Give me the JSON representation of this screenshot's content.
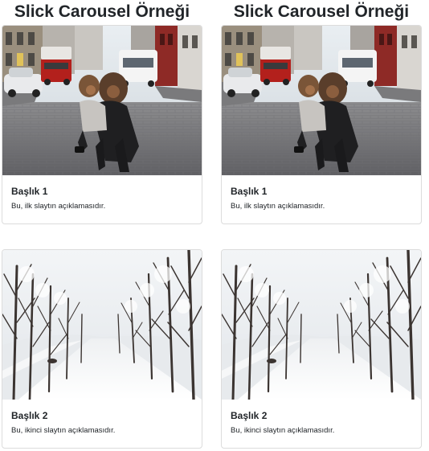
{
  "carousels": [
    {
      "heading": "Slick Carousel Örneği",
      "slides": [
        {
          "title": "Başlık 1",
          "description": "Bu, ilk slaytın açıklamasıdır.",
          "image": "street-mother-child-photo"
        },
        {
          "title": "Başlık 2",
          "description": "Bu, ikinci slaytın açıklamasıdır.",
          "image": "snowy-tree-lined-road-photo"
        }
      ]
    },
    {
      "heading": "Slick Carousel Örneği",
      "slides": [
        {
          "title": "Başlık 1",
          "description": "Bu, ilk slaytın açıklamasıdır.",
          "image": "street-mother-child-photo"
        },
        {
          "title": "Başlık 2",
          "description": "Bu, ikinci slaytın açıklamasıdır.",
          "image": "snowy-tree-lined-road-photo"
        }
      ]
    }
  ],
  "colors": {
    "text": "#212529",
    "card_border": "#dcdcdc",
    "background": "#ffffff"
  }
}
